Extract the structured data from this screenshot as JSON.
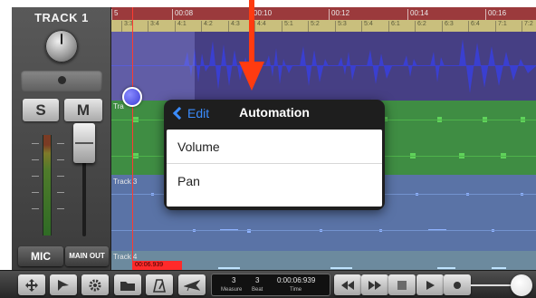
{
  "track": {
    "title": "TRACK 1",
    "solo_label": "S",
    "mute_label": "M",
    "mic_label": "MIC",
    "main_out_label": "MAIN OUT"
  },
  "ruler": {
    "times": [
      "5",
      "00:08",
      "00:10",
      "00:12",
      "00:14",
      "00:16"
    ],
    "measures": [
      "3:3",
      "3:4",
      "4:1",
      "4:2",
      "4:3",
      "4:4",
      "5:1",
      "5:2",
      "5:3",
      "5:4",
      "6:1",
      "6:2",
      "6:3",
      "6:4",
      "7:1",
      "7:2"
    ]
  },
  "lanes": {
    "track2_label": "Tra",
    "track3_label": "Track 3",
    "track4_label": "Track 4"
  },
  "playhead_time": "00:06.939",
  "automation_popover": {
    "back_label": "Edit",
    "title": "Automation",
    "items": [
      "Volume",
      "Pan"
    ]
  },
  "transport": {
    "measure_value": "3",
    "beat_value": "3",
    "time_value": "0:00:06:939",
    "measure_caption": "Measure",
    "beat_caption": "Beat",
    "time_caption": "Time"
  },
  "colors": {
    "track1_lane": "#463f84",
    "track2_lane": "#3f8d43",
    "track3_lane": "#5a73a6",
    "playhead": "#ff3b30",
    "annotation_arrow": "#ff3b10",
    "accent_blue": "#3b8cff"
  },
  "icons": [
    "move-icon",
    "play-cursor-icon",
    "gear-icon",
    "folder-icon",
    "metronome-icon",
    "plane-icon",
    "rewind-icon",
    "fast-forward-icon",
    "stop-icon",
    "play-icon",
    "record-icon"
  ]
}
